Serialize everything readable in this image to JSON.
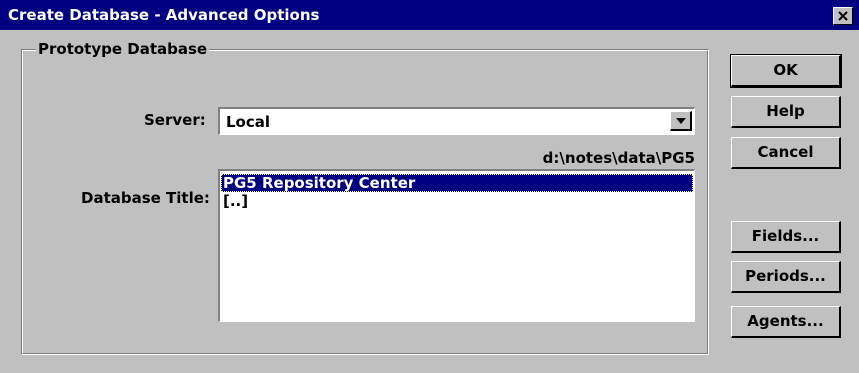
{
  "window": {
    "title": "Create Database - Advanced Options"
  },
  "groupbox": {
    "legend": "Prototype Database"
  },
  "server": {
    "label": "Server:",
    "selected_value": "Local"
  },
  "path": "d:\\notes\\data\\PG5",
  "database_title": {
    "label": "Database Title:",
    "items": [
      "PG5 Repository Center",
      "[..]"
    ],
    "selected_index": 0
  },
  "buttons": {
    "ok": "OK",
    "help": "Help",
    "cancel": "Cancel",
    "fields": "Fields...",
    "periods": "Periods...",
    "agents": "Agents..."
  },
  "colors": {
    "titlebar": "#000080",
    "face": "#c0c0c0",
    "selection": "#000080"
  }
}
